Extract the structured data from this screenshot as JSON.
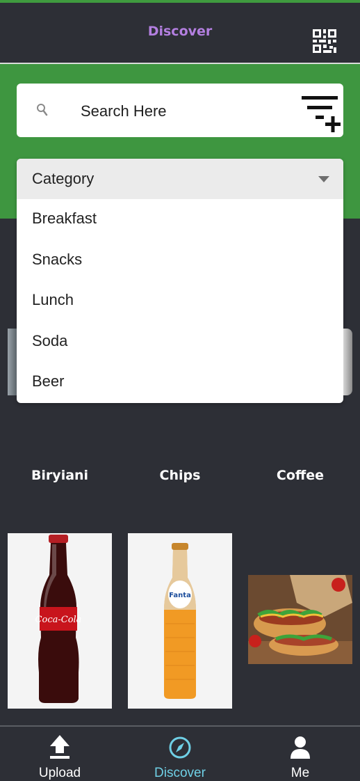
{
  "header": {
    "title": "Discover",
    "qr_icon": "qr-code-icon"
  },
  "colors": {
    "accent_title": "#b37fe0",
    "band_green": "#3e9640",
    "active_nav": "#6fd0e6",
    "background": "#2d2f36"
  },
  "search": {
    "placeholder": "Search Here",
    "value": "",
    "icon": "search-icon",
    "filter_icon": "filter-add-icon"
  },
  "category_dropdown": {
    "label": "Category",
    "options": [
      "Breakfast",
      "Snacks",
      "Lunch",
      "Soda",
      "Beer"
    ]
  },
  "categories": [
    {
      "label": "Biryiani"
    },
    {
      "label": "Chips"
    },
    {
      "label": "Coffee"
    }
  ],
  "nav": [
    {
      "label": "Upload",
      "icon": "upload-icon",
      "active": false
    },
    {
      "label": "Discover",
      "icon": "compass-icon",
      "active": true
    },
    {
      "label": "Me",
      "icon": "person-icon",
      "active": false
    }
  ]
}
